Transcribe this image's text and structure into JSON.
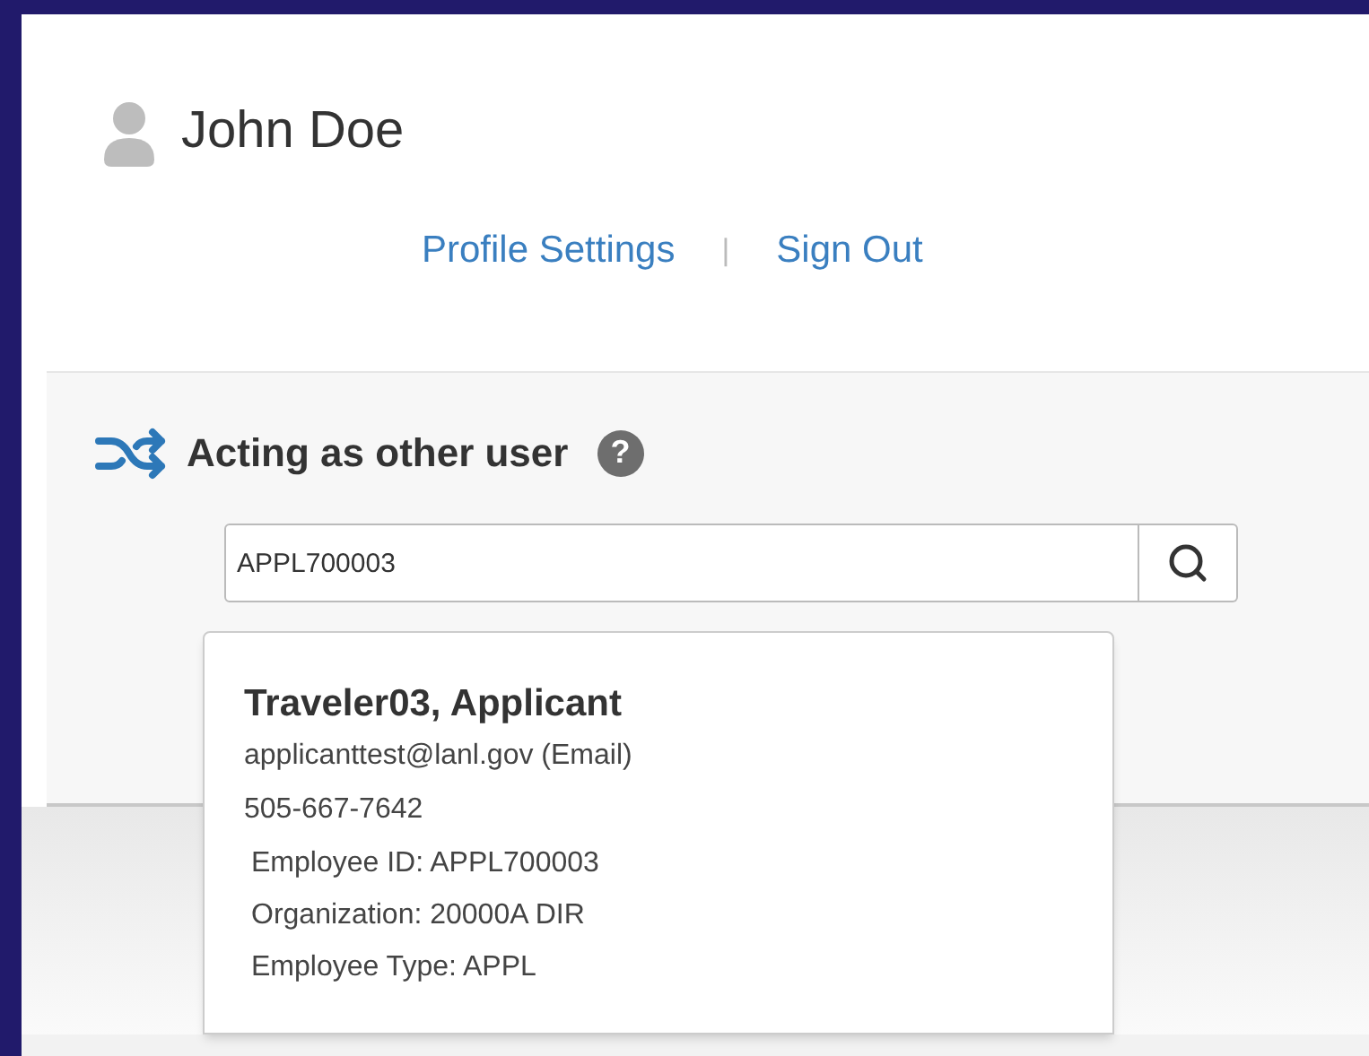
{
  "user": {
    "name": "John Doe"
  },
  "links": [
    {
      "label": "Profile Settings"
    },
    {
      "label": "|",
      "kind": "separator"
    },
    {
      "label": "Sign Out"
    }
  ],
  "acting": {
    "title": "Acting as other user",
    "help": "?",
    "search": {
      "value": "APPL700003"
    }
  },
  "suggestion": {
    "name": "Traveler03, Applicant",
    "lines": [
      "applicanttest@lanl.gov (Email)",
      "505-667-7642"
    ],
    "details": [
      "Employee ID: APPL700003",
      "Organization: 20000A DIR",
      "Employee Type: APPL"
    ]
  }
}
